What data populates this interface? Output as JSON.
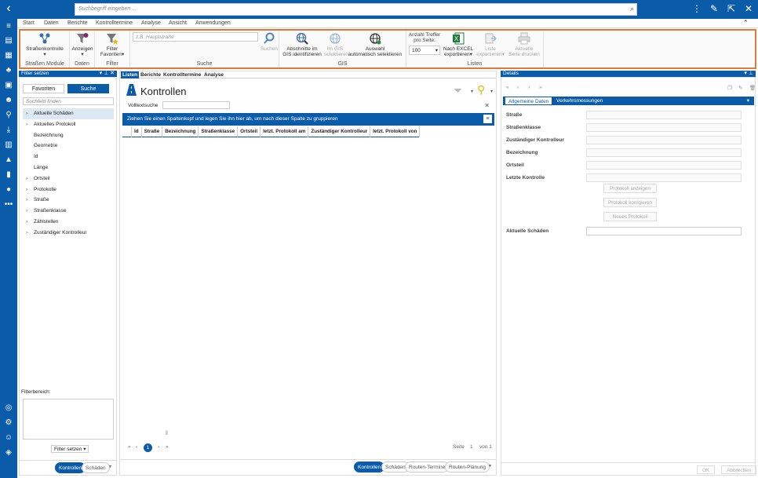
{
  "header": {
    "search_placeholder": "Suchbegriff eingeben ..."
  },
  "menu": [
    "Start",
    "Daten",
    "Berichte",
    "Kontrolltermine",
    "Analyse",
    "Ansicht",
    "Anwendungen"
  ],
  "ribbon": {
    "strassenkontrolle": "Straßenkontrolle",
    "grp_module": "Straßen Module",
    "anzeigen": "Anzeigen",
    "grp_daten": "Daten",
    "filter_line1": "Filter",
    "filter_line2": "Favoriten",
    "grp_filter": "Filter",
    "search_placeholder": "z.B. Hauptstraße",
    "suchen": "Suchen",
    "grp_suche": "Suche",
    "abschnitte_1": "Abschnitte im",
    "abschnitte_2": "GIS identifizieren",
    "imgis_1": "Im GIS",
    "imgis_2": "selektieren",
    "auswahl_1": "Auswahl",
    "auswahl_2": "automatisch selektieren",
    "grp_gis": "GIS",
    "anzahl_1": "Anzahl Treffer",
    "anzahl_2": "pro Seite:",
    "anzahl_value": "100",
    "excel_1": "Nach EXCEL",
    "excel_2": "exportieren",
    "liste_1": "Liste",
    "liste_2": "exportieren",
    "drucken_1": "Aktuelle",
    "drucken_2": "Seite drucken",
    "grp_listen": "Listen"
  },
  "left_panel": {
    "title": "Filter setzen",
    "tab_favoriten": "Favoriten",
    "tab_suche": "Suche",
    "search_placeholder": "Suchfeld finden",
    "tree": [
      {
        "label": "Aktuelle Schäden",
        "expandable": true,
        "selected": true
      },
      {
        "label": "Aktuelles Protokoll",
        "expandable": true
      },
      {
        "label": "Bezeichnung",
        "expandable": false
      },
      {
        "label": "Geometrie",
        "expandable": false
      },
      {
        "label": "Id",
        "expandable": false
      },
      {
        "label": "Länge",
        "expandable": false
      },
      {
        "label": "Ortsteil",
        "expandable": true
      },
      {
        "label": "Protokolle",
        "expandable": true
      },
      {
        "label": "Straße",
        "expandable": true
      },
      {
        "label": "Straßenklasse",
        "expandable": true
      },
      {
        "label": "Zählstellen",
        "expandable": true
      },
      {
        "label": "Zuständiger Kontrolleur",
        "expandable": true
      }
    ],
    "filterbereich": "Filterbereich:",
    "filter_setzen": "Filter setzen",
    "foot_kontrollen": "Kontrollen",
    "foot_schaeden": "Schäden"
  },
  "center": {
    "tabs": [
      "Listen",
      "Berichte",
      "Kontrolltermine",
      "Analyse"
    ],
    "title": "Kontrollen",
    "volltext": "Volltextsuche",
    "group_hint": "Ziehen Sie einen Spaltenkopf und legen Sie ihn hier ab, um nach dieser Spalte zu gruppieren",
    "columns": [
      "Id",
      "Straße",
      "Bezeichnung",
      "Straßenklasse",
      "Ortsteil",
      "letzt. Protokoll am",
      "Zuständiger Kontrolleur",
      "letzt. Protokoll von"
    ],
    "page_current": "1",
    "seite": "Seite",
    "seite_value": "1",
    "von": "von 1",
    "foot_tabs": [
      "Kontrollen",
      "Schäden",
      "Routen-Termine",
      "Routen-Planung"
    ]
  },
  "right_panel": {
    "title": "Details",
    "tab_allgemein": "Allgemeine Daten",
    "tab_verkehr": "Verkehrsmessungen",
    "fields": [
      "Straße",
      "Straßenklasse",
      "Zuständiger Kontrolleur",
      "Bezeichnung",
      "Ortsteil",
      "Letzte Kontrolle"
    ],
    "btn_protokoll_anzeigen": "Protokoll anzeigen",
    "btn_protokoll_korrigieren": "Protokoll korrigieren",
    "btn_neues_protokoll": "Neues Protokoll",
    "aktuelle_schaeden": "Aktuelle Schäden",
    "ok": "OK",
    "abbrechen": "Abbrechen"
  }
}
